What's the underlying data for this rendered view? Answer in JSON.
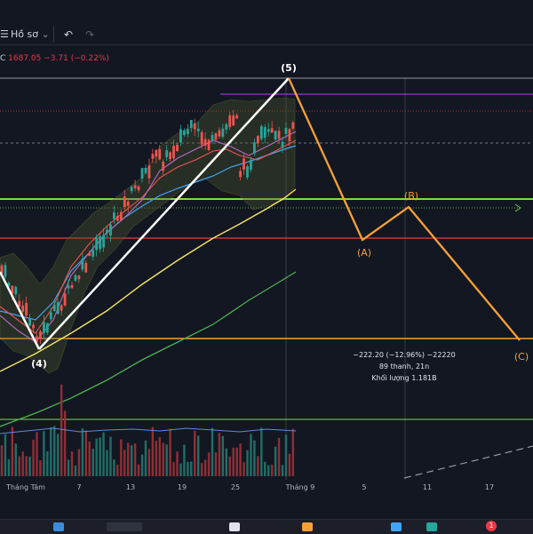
{
  "toolbar": {
    "profile_label": "Hồ sơ",
    "profile_caret": "⌄",
    "undo_icon": "undo-icon",
    "redo_icon": "redo-icon",
    "menu_icon": "hamburger-icon"
  },
  "quote": {
    "prefix": "C",
    "close": "1687.05",
    "change": "−3.71",
    "change_pct": "(−0.22%)",
    "color": "#f23645"
  },
  "measure": {
    "line1": "−222.20 (−12.96%) −22220",
    "line2": "89 thanh, 21n",
    "line3": "Khối lượng 1.181B"
  },
  "chart_data": {
    "type": "candlestick",
    "x_axis_labels": [
      "Tháng Tám",
      "7",
      "13",
      "19",
      "25",
      "Tháng 9",
      "5",
      "11",
      "17"
    ],
    "wave_labels": [
      "(4)",
      "(5)",
      "(A)",
      "(B)",
      "(C)"
    ],
    "wave_label_colors": {
      "(4)": "#ffffff",
      "(5)": "#ffffff",
      "(A)": "#f7a135",
      "(B)": "#f7a135",
      "(C)": "#f7a135"
    },
    "colors": {
      "up": "#26a69a",
      "down": "#ef5350",
      "projection": "#f7a135",
      "impulse": "#ffffff",
      "ma_yellow": "#f5e663",
      "ma_green": "#4caf50",
      "ma_blue": "#42a5f5",
      "level_green": "#7ed957",
      "level_red": "#f23645",
      "level_orange": "#f7a135",
      "level_purple": "#b042ff"
    },
    "grid": false
  },
  "taskbar": {
    "badge": "1"
  }
}
